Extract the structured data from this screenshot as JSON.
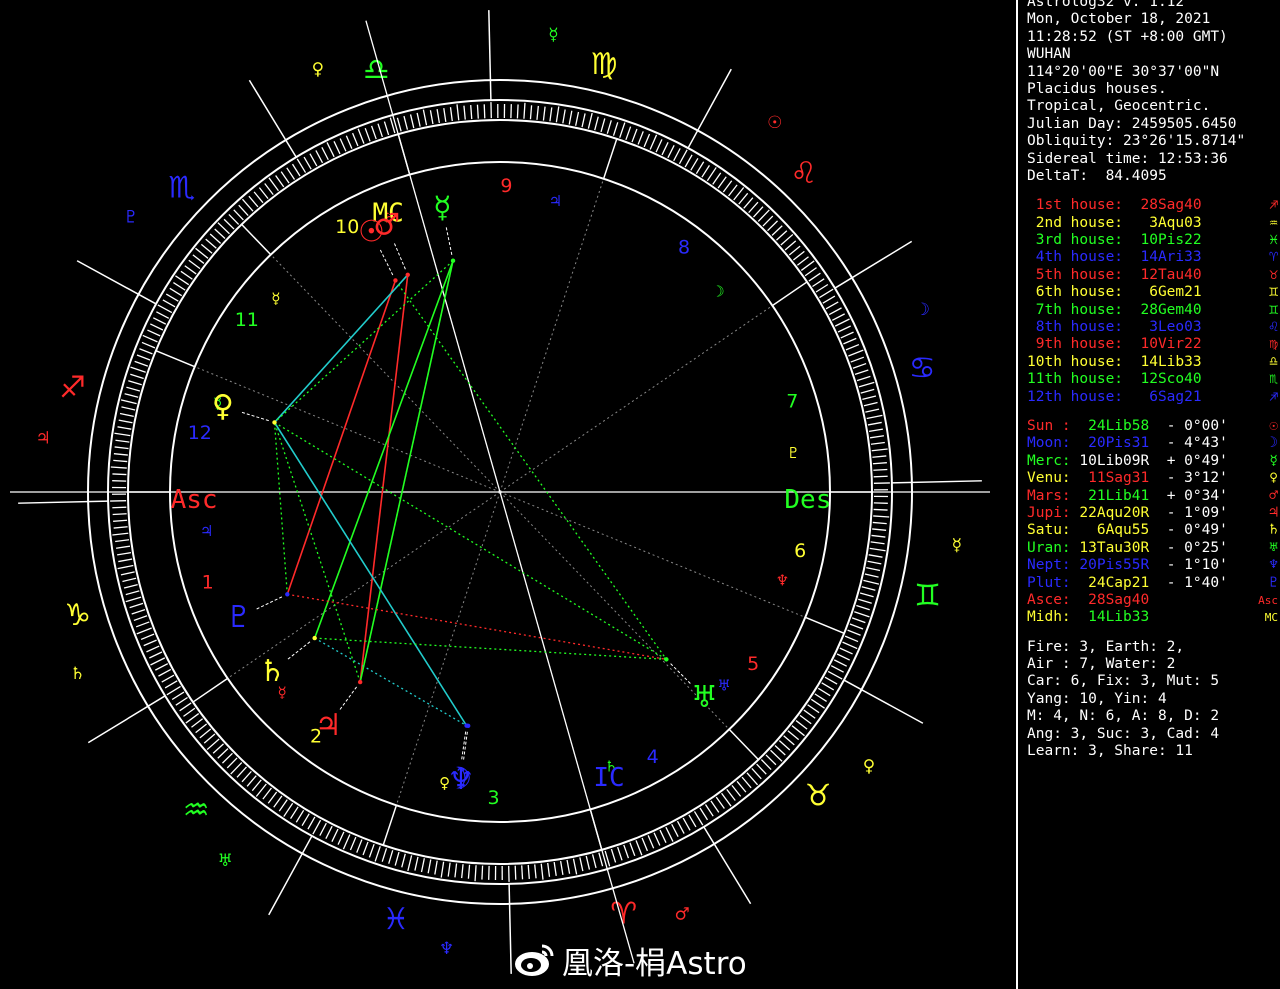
{
  "app": {
    "header": [
      "Astrolog32 v. 1.12",
      "Mon, October 18, 2021",
      "11:28:52 (ST +8:00 GMT)",
      "WUHAN",
      "114°20'00\"E 30°37'00\"N",
      "Placidus houses.",
      "Tropical, Geocentric.",
      "Julian Day: 2459505.6450",
      "Obliquity: 23°26'15.8714\"",
      "Sidereal time: 12:53:36",
      "DeltaT:  84.4095"
    ]
  },
  "houses": [
    {
      "label": "1st house:",
      "value": "28Sag40",
      "color": "#ff2a2a",
      "glyph": "♐"
    },
    {
      "label": "2nd house:",
      "value": "3Aqu03",
      "color": "#ffff33",
      "glyph": "♒"
    },
    {
      "label": "3rd house:",
      "value": "10Pis22",
      "color": "#22ff22",
      "glyph": "♓"
    },
    {
      "label": "4th house:",
      "value": "14Ari33",
      "color": "#2a2aff",
      "glyph": "♈"
    },
    {
      "label": "5th house:",
      "value": "12Tau40",
      "color": "#ff2a2a",
      "glyph": "♉"
    },
    {
      "label": "6th house:",
      "value": "6Gem21",
      "color": "#ffff33",
      "glyph": "♊"
    },
    {
      "label": "7th house:",
      "value": "28Gem40",
      "color": "#22ff22",
      "glyph": "♊"
    },
    {
      "label": "8th house:",
      "value": "3Leo03",
      "color": "#2a2aff",
      "glyph": "♌"
    },
    {
      "label": "9th house:",
      "value": "10Vir22",
      "color": "#ff2a2a",
      "glyph": "♍"
    },
    {
      "label": "10th house:",
      "value": "14Lib33",
      "color": "#ffff33",
      "glyph": "♎"
    },
    {
      "label": "11th house:",
      "value": "12Sco40",
      "color": "#22ff22",
      "glyph": "♏"
    },
    {
      "label": "12th house:",
      "value": "6Sag21",
      "color": "#2a2aff",
      "glyph": "♐"
    }
  ],
  "planets": [
    {
      "name": "Sun :",
      "name_color": "#ff2a2a",
      "pos": "24Lib58",
      "pos_color": "#22ff22",
      "lat": " - 0°00'",
      "glyph": "☉",
      "glyph_color": "#ff2a2a"
    },
    {
      "name": "Moon:",
      "name_color": "#2a2aff",
      "pos": "20Pis31",
      "pos_color": "#2a2aff",
      "lat": " - 4°43'",
      "glyph": "☽",
      "glyph_color": "#2a2aff"
    },
    {
      "name": "Merc:",
      "name_color": "#22ff22",
      "pos": "10Lib09R",
      "pos_color": "#ffffff",
      "lat": " + 0°49'",
      "glyph": "☿",
      "glyph_color": "#22ff22"
    },
    {
      "name": "Venu:",
      "name_color": "#ffff33",
      "pos": "11Sag31",
      "pos_color": "#ff2a2a",
      "lat": " - 3°12'",
      "glyph": "♀",
      "glyph_color": "#ffff33"
    },
    {
      "name": "Mars:",
      "name_color": "#ff2a2a",
      "pos": "21Lib41",
      "pos_color": "#22ff22",
      "lat": " + 0°34'",
      "glyph": "♂",
      "glyph_color": "#ff2a2a"
    },
    {
      "name": "Jupi:",
      "name_color": "#ff2a2a",
      "pos": "22Aqu20R",
      "pos_color": "#ffff33",
      "lat": " - 1°09'",
      "glyph": "♃",
      "glyph_color": "#ff2a2a"
    },
    {
      "name": "Satu:",
      "name_color": "#ffff33",
      "pos": "6Aqu55",
      "pos_color": "#ffff33",
      "lat": " - 0°49'",
      "glyph": "♄",
      "glyph_color": "#ffff33"
    },
    {
      "name": "Uran:",
      "name_color": "#22ff22",
      "pos": "13Tau30R",
      "pos_color": "#ffff33",
      "lat": " - 0°25'",
      "glyph": "♅",
      "glyph_color": "#22ff22"
    },
    {
      "name": "Nept:",
      "name_color": "#2a2aff",
      "pos": "20Pis55R",
      "pos_color": "#2a2aff",
      "lat": " - 1°10'",
      "glyph": "♆",
      "glyph_color": "#2a2aff"
    },
    {
      "name": "Plut:",
      "name_color": "#2a2aff",
      "pos": "24Cap21",
      "pos_color": "#ffff33",
      "lat": " - 1°40'",
      "glyph": "♇",
      "glyph_color": "#2a2aff"
    },
    {
      "name": "Asce:",
      "name_color": "#ff2a2a",
      "pos": "28Sag40",
      "pos_color": "#ff2a2a",
      "lat": "",
      "glyph": "Asc",
      "glyph_color": "#ff2a2a"
    },
    {
      "name": "Midh:",
      "name_color": "#ffff33",
      "pos": "14Lib33",
      "pos_color": "#22ff22",
      "lat": "",
      "glyph": "MC",
      "glyph_color": "#ffff33"
    }
  ],
  "stats": [
    "Fire: 3, Earth: 2,",
    "Air : 7, Water: 2",
    "Car: 6, Fix: 3, Mut: 5",
    "Yang: 10, Yin: 4",
    "M: 4, N: 6, A: 8, D: 2",
    "Ang: 3, Suc: 3, Cad: 4",
    "Learn: 3, Share: 11"
  ],
  "watermark": {
    "text": "凰洛-梋Astro"
  },
  "wheel": {
    "sign_glyphs": [
      "♈",
      "♉",
      "♊",
      "♋",
      "♌",
      "♍",
      "♎",
      "♏",
      "♐",
      "♑",
      "♒",
      "♓"
    ],
    "sign_colors": [
      "#ff2a2a",
      "#ffff33",
      "#22ff22",
      "#2a2aff",
      "#ff2a2a",
      "#ffff33",
      "#22ff22",
      "#2a2aff",
      "#ff2a2a",
      "#ffff33",
      "#22ff22",
      "#2a2aff"
    ],
    "ruler_glyphs": [
      "♂",
      "♀",
      "☿",
      "☽",
      "☉",
      "☿",
      "♀",
      "♇",
      "♃",
      "♄",
      "♅",
      "♆"
    ],
    "ruler_colors": [
      "#ff2a2a",
      "#ffff33",
      "#ffff33",
      "#2a2aff",
      "#ff2a2a",
      "#22ff22",
      "#ffff33",
      "#2a2aff",
      "#ff2a2a",
      "#ffff33",
      "#22ff22",
      "#2a2aff"
    ],
    "house_numbers": [
      "1",
      "2",
      "3",
      "4",
      "5",
      "6",
      "7",
      "8",
      "9",
      "10",
      "11",
      "12"
    ],
    "house_colors": [
      "#ff2a2a",
      "#ffff33",
      "#22ff22",
      "#2a2aff",
      "#ff2a2a",
      "#ffff33",
      "#22ff22",
      "#2a2aff",
      "#ff2a2a",
      "#ffff33",
      "#22ff22",
      "#2a2aff"
    ],
    "house_cusp_longitudes": [
      268.67,
      303.05,
      340.37,
      14.55,
      42.67,
      66.35,
      88.67,
      123.05,
      160.37,
      194.55,
      222.67,
      246.35
    ],
    "house_sublords": [
      "♃",
      "☿",
      "♀",
      "♄",
      "♅",
      "♆",
      "♇",
      "☽",
      "♃",
      "♄",
      "☿",
      "☿"
    ],
    "axis_labels": {
      "asc": "Asc",
      "des": "Des",
      "mc": "MC",
      "ic": "IC"
    },
    "bodies": [
      {
        "name": "Sun",
        "glyph": "☉",
        "lon": 204.97,
        "color": "#ff2a2a"
      },
      {
        "name": "Mars",
        "glyph": "♂",
        "lon": 201.68,
        "color": "#ff2a2a"
      },
      {
        "name": "Mercury",
        "glyph": "☿",
        "lon": 190.15,
        "color": "#22ff22"
      },
      {
        "name": "Venus",
        "glyph": "♀",
        "lon": 251.52,
        "color": "#ffff33"
      },
      {
        "name": "Pluto",
        "glyph": "♇",
        "lon": 294.35,
        "color": "#2a2aff"
      },
      {
        "name": "Saturn",
        "glyph": "♄",
        "lon": 306.92,
        "color": "#ffff33"
      },
      {
        "name": "Jupiter",
        "glyph": "♃",
        "lon": 322.33,
        "color": "#ff2a2a"
      },
      {
        "name": "Neptune",
        "glyph": "♆",
        "lon": 350.92,
        "color": "#2a2aff"
      },
      {
        "name": "Moon",
        "glyph": "☽",
        "lon": 350.52,
        "color": "#2a2aff"
      },
      {
        "name": "Uranus",
        "glyph": "♅",
        "lon": 43.5,
        "color": "#22ff22"
      }
    ]
  }
}
